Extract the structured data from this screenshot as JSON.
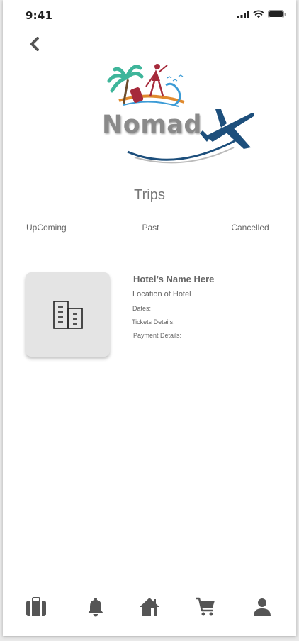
{
  "status_bar": {
    "time": "9:41"
  },
  "logo": {
    "text": "Nomad"
  },
  "page": {
    "title": "Trips"
  },
  "tabs": [
    {
      "label": "UpComing"
    },
    {
      "label": "Past"
    },
    {
      "label": "Cancelled"
    }
  ],
  "trip": {
    "hotel_name": "Hotel’s  Name Here",
    "location": "Location of Hotel",
    "dates": "Dates:",
    "tickets": "Tickets Details:",
    "payment": "Payment Details:"
  },
  "colors": {
    "icon": "#555555",
    "plane": "#1d4f7c",
    "accent": "#e08a2e"
  },
  "bottom_nav": [
    {
      "icon": "briefcase-icon"
    },
    {
      "icon": "bell-icon"
    },
    {
      "icon": "home-icon"
    },
    {
      "icon": "cart-icon"
    },
    {
      "icon": "user-icon"
    }
  ]
}
